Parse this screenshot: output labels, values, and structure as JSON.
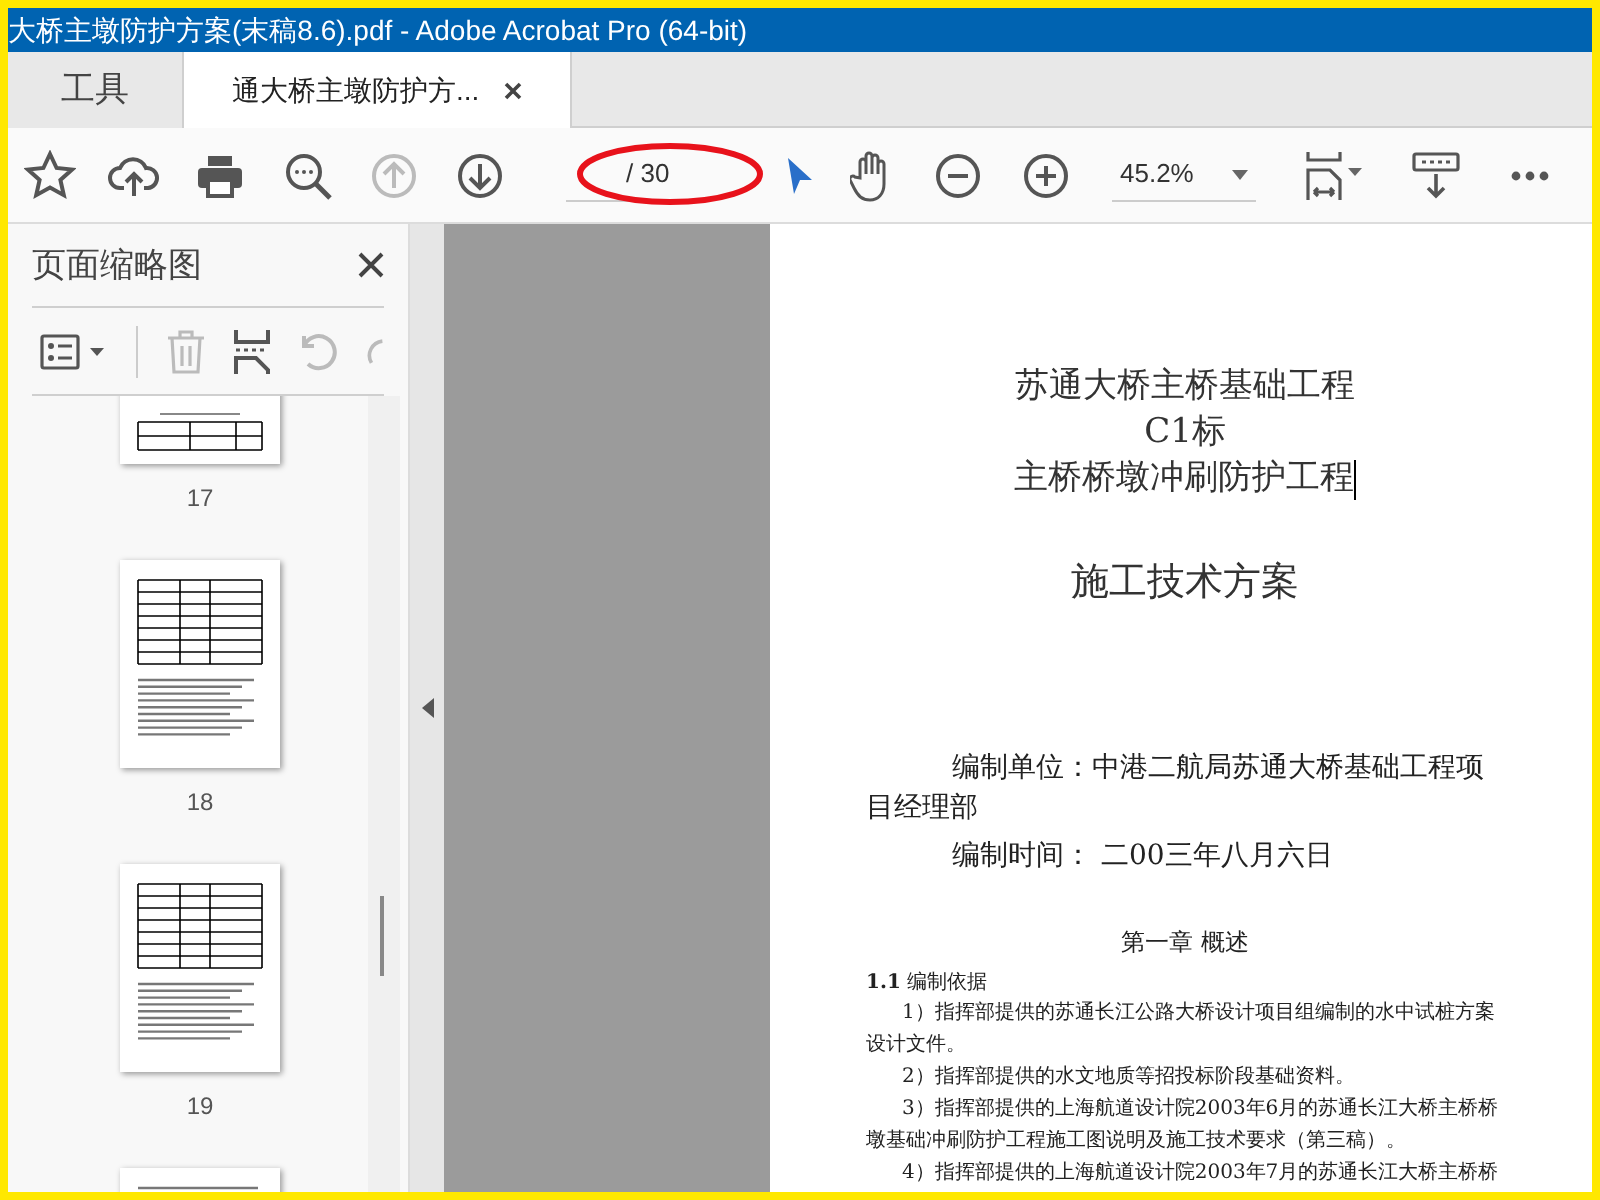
{
  "window": {
    "title": "大桥主墩防护方案(末稿8.6).pdf - Adobe Acrobat Pro (64-bit)"
  },
  "tabs": [
    {
      "label": "工具",
      "selected": false,
      "closable": false
    },
    {
      "label": "通大桥主墩防护方...",
      "selected": true,
      "closable": true
    }
  ],
  "toolbar": {
    "page_field": {
      "total": "/ 30"
    },
    "zoom": "45.2%",
    "annotation_ellipse": true
  },
  "sidebar": {
    "title": "页面缩略图",
    "thumbnails": [
      {
        "page": "17",
        "kind": "table-end"
      },
      {
        "page": "18",
        "kind": "table-text"
      },
      {
        "page": "19",
        "kind": "table-text"
      },
      {
        "kind": "text"
      }
    ]
  },
  "document": {
    "blocks": [
      {
        "kind": "title",
        "text": "苏通大桥主桥基础工程"
      },
      {
        "kind": "title",
        "text": "C1标"
      },
      {
        "kind": "title",
        "text": "主桥桥墩冲刷防护工程",
        "caret": true
      },
      {
        "kind": "subtitle",
        "text": "施工技术方案"
      },
      {
        "kind": "info",
        "text": "编制单位：中港二航局苏通大桥基础工程项目经理部"
      },
      {
        "kind": "info",
        "text": "编制时间：  二00三年八月六日"
      },
      {
        "kind": "chapter",
        "text": "第一章  概述"
      },
      {
        "kind": "section",
        "text": "**1.1** 编制依据"
      },
      {
        "kind": "item",
        "text": "1）指挥部提供的苏通长江公路大桥设计项目组编制的水中试桩方案设计文件。"
      },
      {
        "kind": "item",
        "text": "2）指挥部提供的水文地质等招投标阶段基础资料。"
      },
      {
        "kind": "item",
        "text": "3）指挥部提供的上海航道设计院2003年6月的苏通长江大桥主桥桥墩基础冲刷防护工程施工图说明及施工技术要求（第三稿）。"
      },
      {
        "kind": "item",
        "text": "4）指挥部提供的上海航道设计院2003年7月的苏通长江大桥主桥桥"
      }
    ]
  }
}
